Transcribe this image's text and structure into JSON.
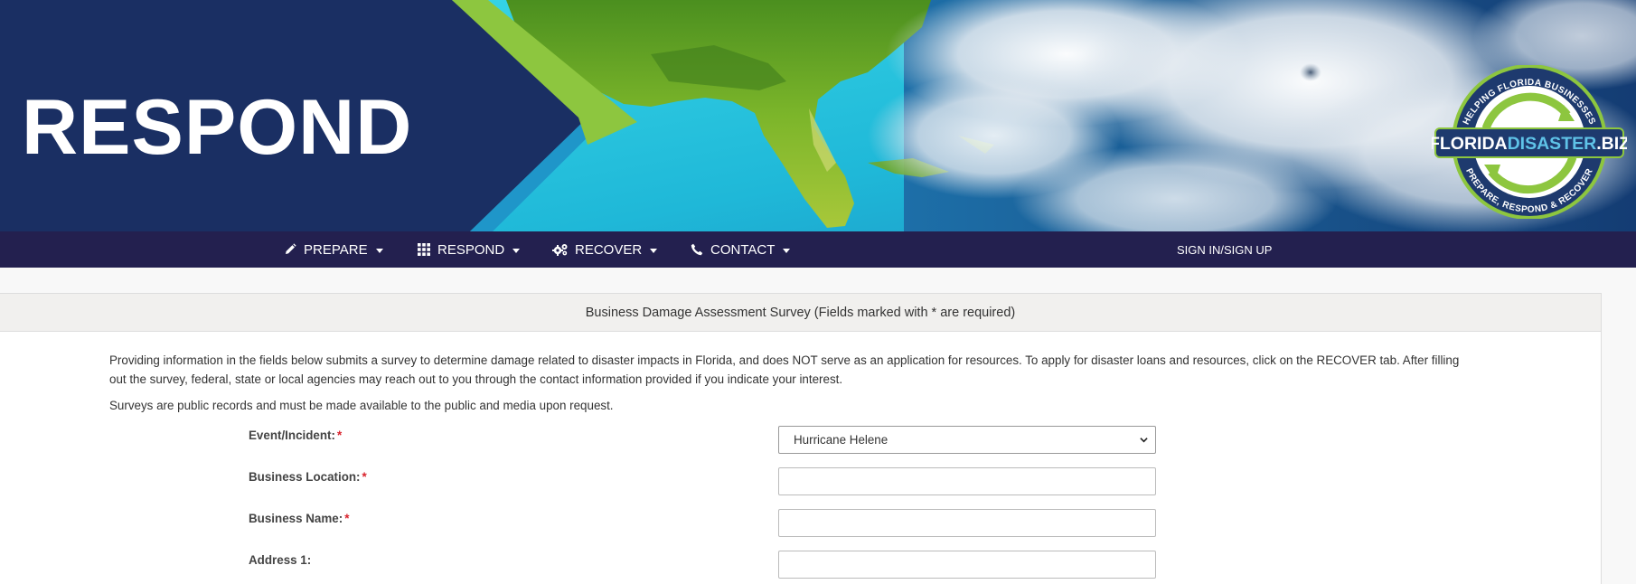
{
  "banner": {
    "title": "RESPOND",
    "logo": {
      "top_arc": "HELPING FLORIDA BUSINESSES",
      "name_part1": "FLORIDA",
      "name_part2": "DISASTER",
      "name_part3": ".BIZ",
      "bottom_arc": "PREPARE, RESPOND & RECOVER"
    }
  },
  "nav": {
    "items": [
      {
        "label": "PREPARE",
        "icon": "pencil-icon"
      },
      {
        "label": "RESPOND",
        "icon": "grid-icon"
      },
      {
        "label": "RECOVER",
        "icon": "gears-icon"
      },
      {
        "label": "CONTACT",
        "icon": "phone-icon"
      }
    ],
    "signin": "SIGN IN/SIGN UP"
  },
  "survey": {
    "header": "Business Damage Assessment Survey (Fields marked with * are required)",
    "intro": "Providing information in the fields below submits a survey to determine damage related to disaster impacts in Florida, and does NOT serve as an application for resources. To apply for disaster loans and resources, click on the RECOVER tab. After filling out the survey, federal, state or local agencies may reach out to you through the contact information provided if you indicate your interest.",
    "note": "Surveys are public records and must be made available to the public and media upon request.",
    "fields": {
      "event": {
        "label": "Event/Incident:",
        "required": "*",
        "value": "Hurricane Helene"
      },
      "location": {
        "label": "Business Location:",
        "required": "*",
        "value": ""
      },
      "name": {
        "label": "Business Name:",
        "required": "*",
        "value": ""
      },
      "address1": {
        "label": "Address 1:",
        "value": ""
      }
    }
  },
  "colors": {
    "banner_navy": "#1a2f63",
    "accent_green": "#8dc63f",
    "accent_blue": "#1f96c9",
    "nav_bg": "#23204f",
    "required_red": "#d9232d"
  }
}
